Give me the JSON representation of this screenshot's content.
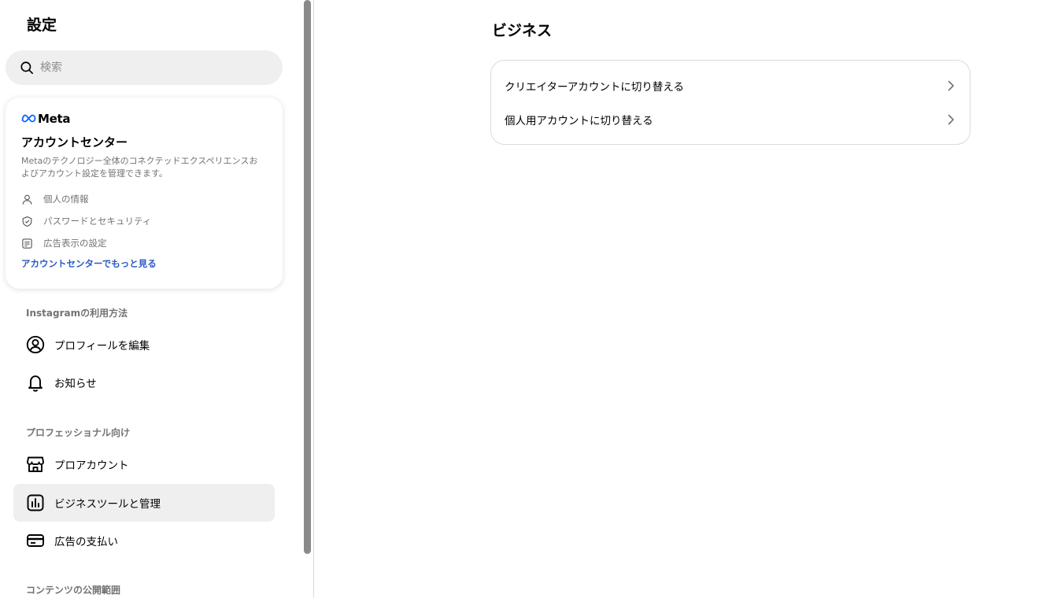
{
  "sidebar": {
    "title": "設定",
    "search": {
      "placeholder": "検索",
      "value": ""
    },
    "meta_card": {
      "brand": "Meta",
      "title": "アカウントセンター",
      "description": "Metaのテクノロジー全体のコネクテッドエクスペリエンスおよびアカウント設定を管理できます。",
      "items": [
        {
          "label": "個人の情報",
          "icon": "person-icon"
        },
        {
          "label": "パスワードとセキュリティ",
          "icon": "shield-icon"
        },
        {
          "label": "広告表示の設定",
          "icon": "ad-icon"
        }
      ],
      "link": "アカウントセンターでもっと見る",
      "link_color": "#2b59c3"
    },
    "sections": [
      {
        "label": "Instagramの利用方法"
      },
      {
        "label": "プロフェッショナル向け"
      },
      {
        "label": "コンテンツの公開範囲"
      }
    ],
    "nav_items": [
      {
        "label": "プロフィールを編集",
        "icon": "profile-icon"
      },
      {
        "label": "お知らせ",
        "icon": "bell-icon"
      },
      {
        "label": "プロアカウント",
        "icon": "shop-icon"
      },
      {
        "label": "ビジネスツールと管理",
        "icon": "chart-icon",
        "active": true
      },
      {
        "label": "広告の支払い",
        "icon": "card-icon"
      }
    ]
  },
  "main": {
    "title": "ビジネス",
    "options": [
      {
        "label": "クリエイターアカウントに切り替える"
      },
      {
        "label": "個人用アカウントに切り替える"
      }
    ]
  }
}
